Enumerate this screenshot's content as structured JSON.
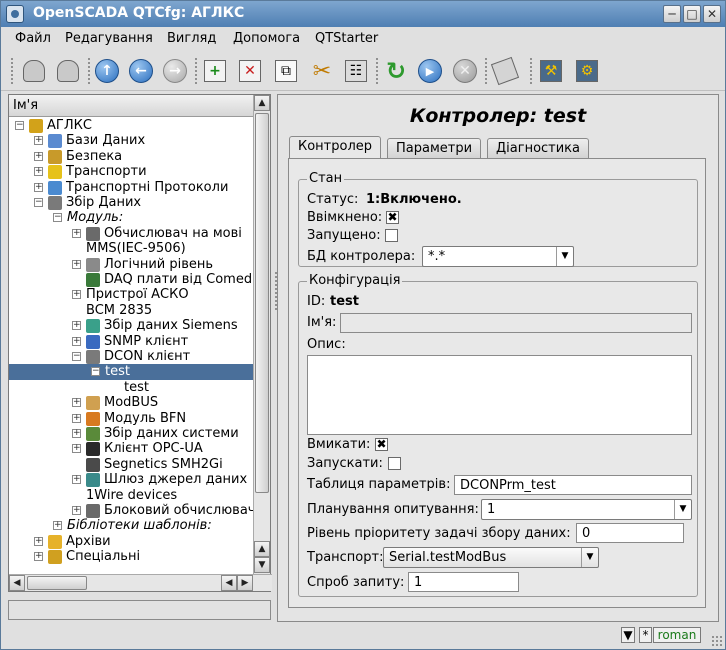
{
  "window": {
    "title": "OpenSCADA QTCfg: АГЛКС"
  },
  "menu": [
    "Файл",
    "Редагування",
    "Вигляд",
    "Допомога",
    "QTStarter"
  ],
  "toolbar": {
    "icons": [
      "db-load-icon",
      "db-save-icon",
      "up-icon",
      "back-icon",
      "forward-icon",
      "add-item-icon",
      "delete-item-icon",
      "copy-icon",
      "cut-icon",
      "paste-icon",
      "refresh-icon",
      "start-icon",
      "stop-icon",
      "info-icon",
      "station-config-icon",
      "station-remote-icon"
    ]
  },
  "tree": {
    "header": "Ім'я",
    "items": [
      {
        "label": "АГЛКС",
        "level": 0,
        "exp": "-",
        "icon": "station"
      },
      {
        "label": "Бази Даних",
        "level": 1,
        "exp": "+",
        "icon": "db"
      },
      {
        "label": "Безпека",
        "level": 1,
        "exp": "+",
        "icon": "security"
      },
      {
        "label": "Транспорти",
        "level": 1,
        "exp": "+",
        "icon": "transport"
      },
      {
        "label": "Транспортні Протоколи",
        "level": 1,
        "exp": "+",
        "icon": "protocol"
      },
      {
        "label": "Збір Даних",
        "level": 1,
        "exp": "-",
        "icon": "daq"
      },
      {
        "label": "Модуль:",
        "level": 2,
        "exp": "-",
        "icon": "",
        "italic": true
      },
      {
        "label": "Обчислювач на мові",
        "level": 3,
        "exp": "+",
        "icon": "calc"
      },
      {
        "label": "MMS(IEC-9506)",
        "level": 3,
        "exp": "",
        "icon": ""
      },
      {
        "label": "Логічний рівень",
        "level": 3,
        "exp": "+",
        "icon": "logic"
      },
      {
        "label": "DAQ плати від Comed",
        "level": 3,
        "exp": "",
        "icon": "board"
      },
      {
        "label": "Пристрої АСКО",
        "level": 3,
        "exp": "+",
        "icon": ""
      },
      {
        "label": "BCM 2835",
        "level": 3,
        "exp": "",
        "icon": ""
      },
      {
        "label": "Збір даних Siemens",
        "level": 3,
        "exp": "+",
        "icon": "siemens"
      },
      {
        "label": "SNMP клієнт",
        "level": 3,
        "exp": "+",
        "icon": "snmp"
      },
      {
        "label": "DCON клієнт",
        "level": 3,
        "exp": "-",
        "icon": "dcon"
      },
      {
        "label": "test",
        "level": 4,
        "exp": "-",
        "icon": "",
        "selected": true
      },
      {
        "label": "test",
        "level": 5,
        "exp": "",
        "icon": ""
      },
      {
        "label": "ModBUS",
        "level": 3,
        "exp": "+",
        "icon": "modbus"
      },
      {
        "label": "Модуль BFN",
        "level": 3,
        "exp": "+",
        "icon": "bfn"
      },
      {
        "label": "Збір даних системи",
        "level": 3,
        "exp": "+",
        "icon": "system"
      },
      {
        "label": "Клієнт OPC-UA",
        "level": 3,
        "exp": "+",
        "icon": "opcua"
      },
      {
        "label": "Segnetics SMH2Gi",
        "level": 3,
        "exp": "",
        "icon": "segnetics"
      },
      {
        "label": "Шлюз джерел даних",
        "level": 3,
        "exp": "+",
        "icon": "gate"
      },
      {
        "label": "1Wire devices",
        "level": 3,
        "exp": "",
        "icon": ""
      },
      {
        "label": "Блоковий обчислювач",
        "level": 3,
        "exp": "+",
        "icon": "block"
      },
      {
        "label": "Бібліотеки шаблонів:",
        "level": 2,
        "exp": "+",
        "icon": "",
        "italic": true
      },
      {
        "label": "Архіви",
        "level": 1,
        "exp": "+",
        "icon": "archive"
      },
      {
        "label": "Спеціальні",
        "level": 1,
        "exp": "+",
        "icon": "special"
      }
    ]
  },
  "panel": {
    "title": "Контролер: test",
    "tabs": [
      "Контролер",
      "Параметри",
      "Діагностика"
    ],
    "state": {
      "group_title": "Стан",
      "status_label": "Статус:",
      "status_value": "1:Включено.",
      "enabled_label": "Ввімкнено:",
      "enabled": true,
      "started_label": "Запущено:",
      "started": false,
      "db_label": "БД контролера:",
      "db_value": "*.*"
    },
    "config": {
      "group_title": "Конфігурація",
      "id_label": "ID:",
      "id_value": "test",
      "name_label": "Ім'я:",
      "name_value": "",
      "descr_label": "Опис:",
      "descr_value": "",
      "enable_label": "Вмикати:",
      "enable": true,
      "start_label": "Запускати:",
      "start": false,
      "prm_table_label": "Таблиця параметрів:",
      "prm_table_value": "DCONPrm_test",
      "schedule_label": "Планування опитування:",
      "schedule_value": "1",
      "priority_label": "Рівень пріоритету задачі збору даних:",
      "priority_value": "0",
      "transport_label": "Транспорт:",
      "transport_value": "Serial.testModBus",
      "attempts_label": "Спроб запиту:",
      "attempts_value": "1"
    }
  },
  "statusbar": {
    "star": "*",
    "lang": "roman"
  }
}
